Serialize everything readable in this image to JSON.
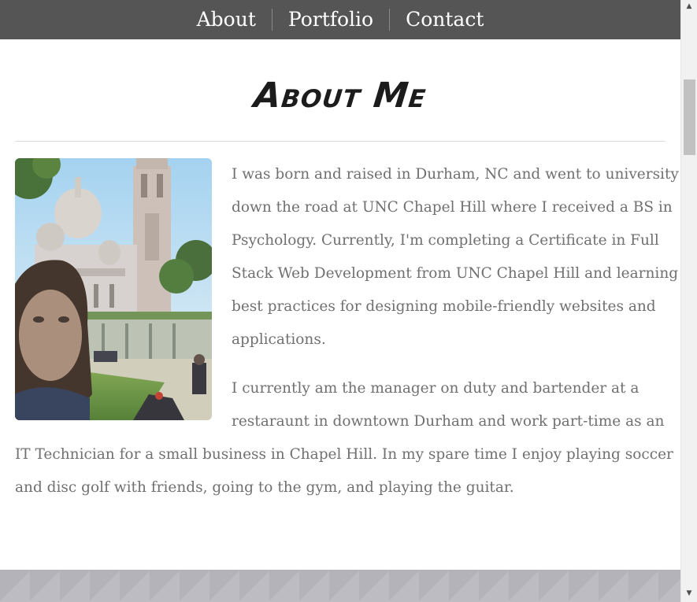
{
  "nav": {
    "items": [
      {
        "label": "About"
      },
      {
        "label": "Portfolio"
      },
      {
        "label": "Contact"
      }
    ]
  },
  "about": {
    "title": "About Me",
    "paragraph1_lines": [
      "I was born and raised in Durham, NC and went to university",
      "down the road at UNC Chapel Hill where I received a BS in",
      "Psychology. Currently, I'm completing a Certificate in Full",
      "Stack Web Development from UNC Chapel Hill and learning",
      "best practices for designing mobile-friendly websites and",
      "applications."
    ],
    "paragraph2_lines": [
      "I currently am the manager on duty and bartender at a",
      "restaraunt in downtown Durham and work part-time as an",
      "IT Technician for a small business in Chapel Hill. In my spare time I enjoy playing soccer",
      "and disc golf with friends, going to the gym, and playing the guitar."
    ]
  },
  "colors": {
    "navbar": "#555555",
    "body_text": "#707070",
    "footer": "#b3b3b9"
  },
  "scrollbar": {
    "up_icon": "▲",
    "down_icon": "▼"
  }
}
